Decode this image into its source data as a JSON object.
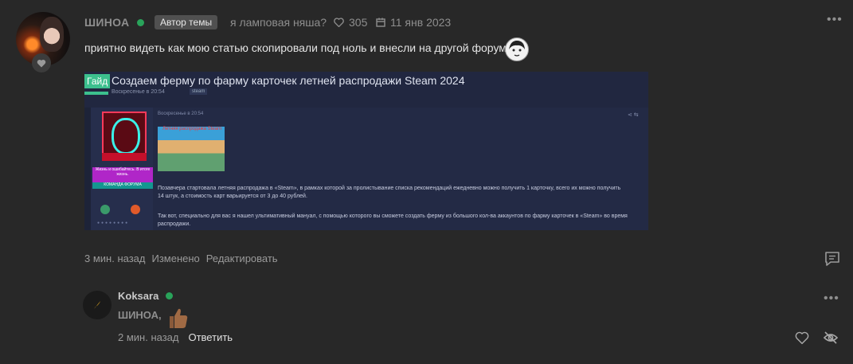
{
  "post": {
    "author": "ШИНОА",
    "author_badge": "Автор темы",
    "status": "я ламповая няша?",
    "likes": "305",
    "date": "11 янв 2023",
    "more": "•••",
    "text": "приятно видеть как мою статью скопировали под ноль и внесли на другой форум",
    "embedded": {
      "tag": "Гайд",
      "title": "Создаем ферму по фарму карточек летней распродажи Steam 2024",
      "subtitle": "Воскресенье в 20:54",
      "sub_tag": "steam",
      "post_date": "Воскресенье в 20:54",
      "thumb_caption": "Летняя распродажа Steam",
      "badge_quote": "Жизнь и ошибайтесь. В итоге жизнь.",
      "badge_team": "КОМАНДА ФОРУМА",
      "paragraph_1": "Позавчера стартовала летняя распродажа в «Steam», в рамках которой за пролистывание списка рекомендаций ежедневно можно получить 1 карточку, всего их можно получить 14 штук, а стоимость карт варьируется от 3 до 40 рублей.",
      "paragraph_2": "Так вот, специально для вас я нашел ультимативный мануал, с помощью которого вы сможете создать ферму из большого кол-ва аккаунтов по фарму карточек в «Steam» во время распродажи."
    },
    "footer": {
      "time": "3 мин. назад",
      "edited": "Изменено",
      "edit": "Редактировать"
    }
  },
  "reply": {
    "author": "Koksara",
    "more": "•••",
    "text": "ШИНОА,",
    "time": "2 мин. назад",
    "answer": "Ответить"
  },
  "colors": {
    "online": "#29a35a",
    "accent_green": "#3cc08e",
    "background": "#282828"
  }
}
